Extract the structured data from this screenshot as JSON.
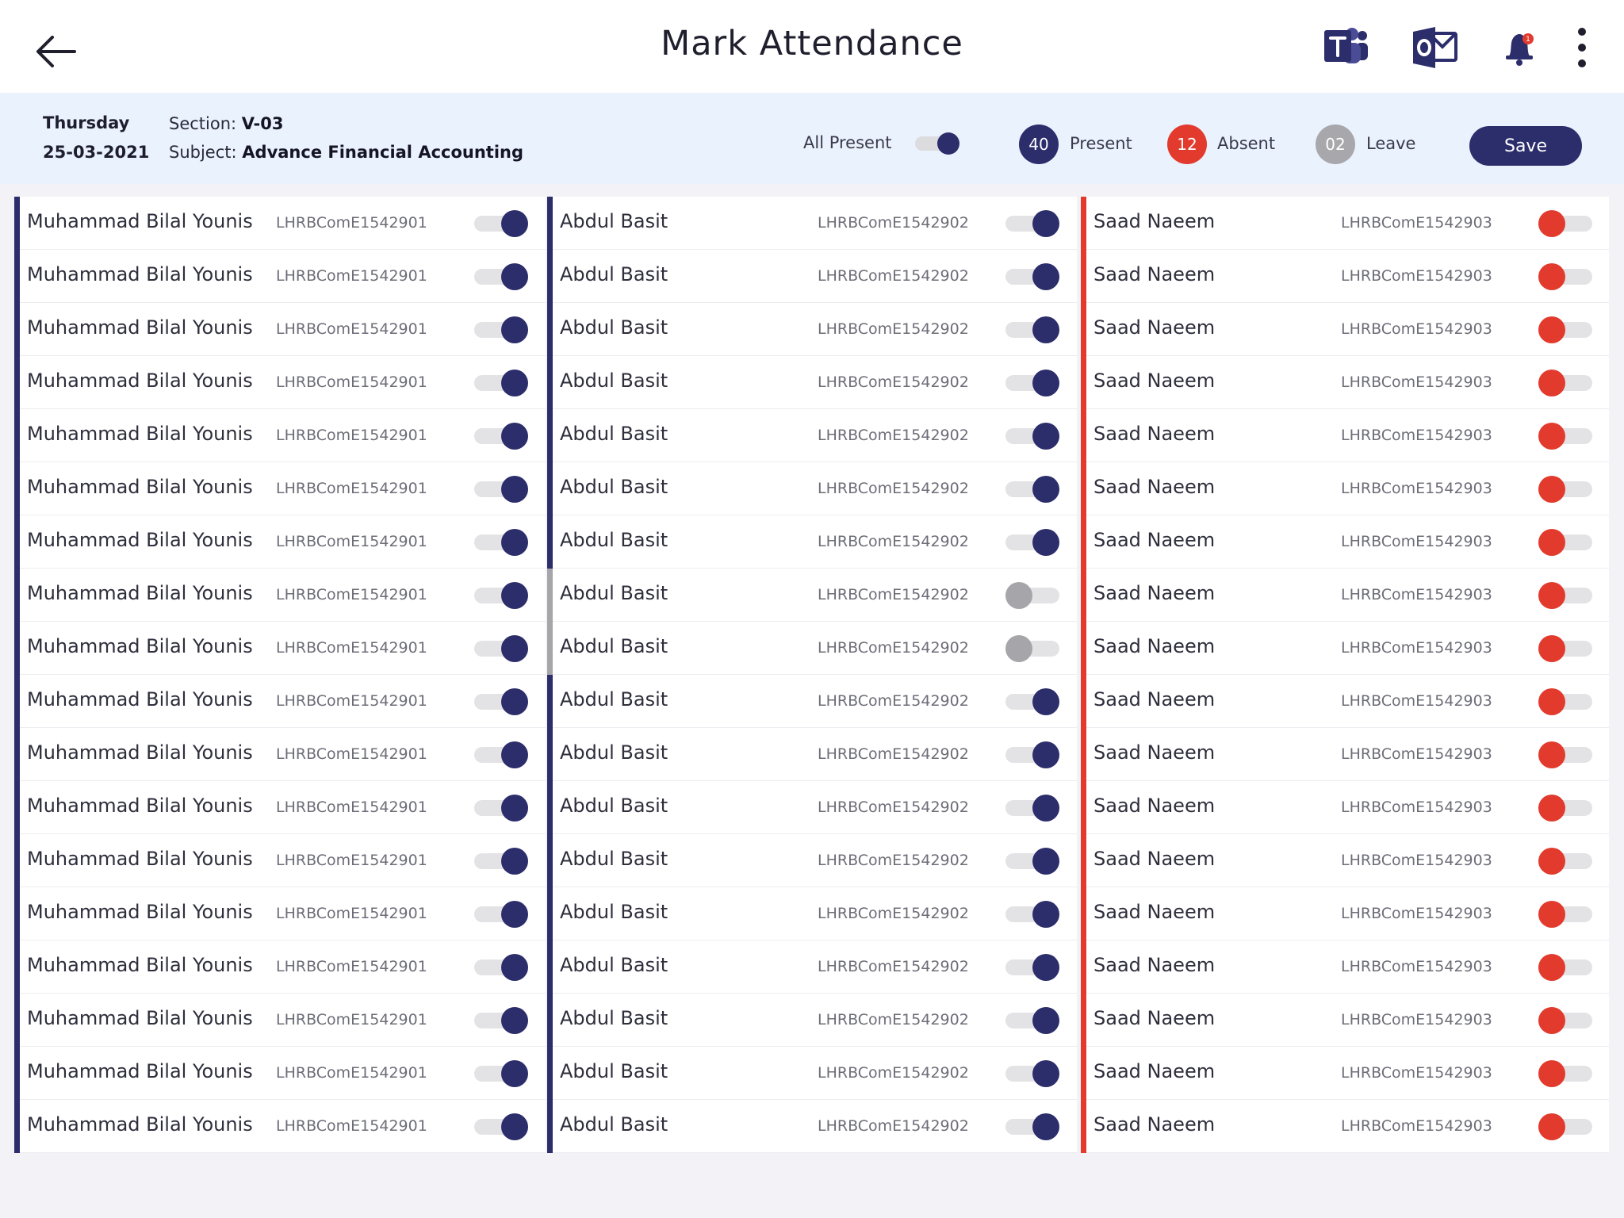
{
  "header": {
    "title": "Mark Attendance",
    "notification_count": "1"
  },
  "info": {
    "day": "Thursday",
    "date": "25-03-2021",
    "section_label": "Section:",
    "section_value": "V-03",
    "subject_label": "Subject:",
    "subject_value": "Advance Financial Accounting",
    "all_present_label": "All Present",
    "all_present_on": true
  },
  "summary": {
    "present_count": "40",
    "present_label": "Present",
    "absent_count": "12",
    "absent_label": "Absent",
    "leave_count": "02",
    "leave_label": "Leave"
  },
  "save_label": "Save",
  "colors": {
    "present": "#2c2d6b",
    "absent": "#e23b2e",
    "leave": "#a6a6aa"
  },
  "columns": [
    {
      "student_name": "Muhammad Bilal Younis",
      "student_id": "LHRBComE1542901",
      "statuses": [
        "present",
        "present",
        "present",
        "present",
        "present",
        "present",
        "present",
        "present",
        "present",
        "present",
        "present",
        "present",
        "present",
        "present",
        "present",
        "present",
        "present",
        "present"
      ]
    },
    {
      "student_name": "Abdul Basit",
      "student_id": "LHRBComE1542902",
      "statuses": [
        "present",
        "present",
        "present",
        "present",
        "present",
        "present",
        "present",
        "leave",
        "leave",
        "present",
        "present",
        "present",
        "present",
        "present",
        "present",
        "present",
        "present",
        "present"
      ]
    },
    {
      "student_name": "Saad Naeem",
      "student_id": "LHRBComE1542903",
      "statuses": [
        "absent",
        "absent",
        "absent",
        "absent",
        "absent",
        "absent",
        "absent",
        "absent",
        "absent",
        "absent",
        "absent",
        "absent",
        "absent",
        "absent",
        "absent",
        "absent",
        "absent",
        "absent"
      ]
    }
  ]
}
